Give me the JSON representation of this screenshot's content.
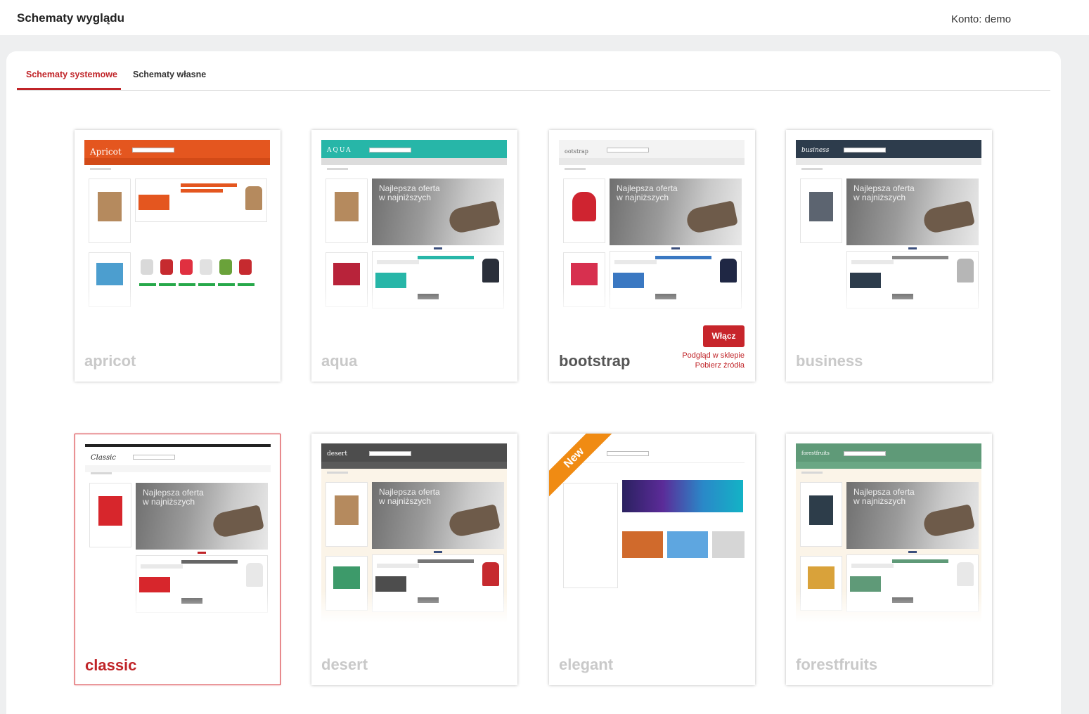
{
  "header": {
    "title": "Schematy wyglądu",
    "account": "Konto: demo"
  },
  "tabs": [
    {
      "label": "Schematy systemowe",
      "active": true
    },
    {
      "label": "Schematy własne",
      "active": false
    }
  ],
  "colors": {
    "accent": "#c02428",
    "ribbon": "#f08b13"
  },
  "themes": [
    {
      "name": "apricot",
      "logo": "Apricot",
      "header_color": "#e4561f",
      "nav_color": "#d24a17"
    },
    {
      "name": "aqua",
      "logo": "AQUA",
      "header_color": "#27b6a8",
      "nav_color": "#dcdcdc"
    },
    {
      "name": "bootstrap",
      "logo": "ootstrap",
      "header_color": "#f3f3f3",
      "nav_color": "#e8e8e8",
      "actions": {
        "enable": "Włącz",
        "preview": "Podgląd w sklepie",
        "download": "Pobierz źródła"
      }
    },
    {
      "name": "business",
      "logo": "business",
      "header_color": "#2d3c4c",
      "nav_color": "#e8e8e8"
    },
    {
      "name": "classic",
      "logo": "Classic",
      "header_color": "#ffffff",
      "nav_color": "#f5f5f5",
      "selected": true
    },
    {
      "name": "desert",
      "logo": "desert",
      "header_color": "#4d4d4d",
      "nav_color": "#5a5a5a"
    },
    {
      "name": "elegant",
      "logo": "",
      "header_color": "#ffffff",
      "nav_color": "#f3f3f3",
      "badge": "New"
    },
    {
      "name": "forestfruits",
      "logo": "forestfruits",
      "header_color": "#5f9a78",
      "nav_color": "#6aa784"
    }
  ]
}
